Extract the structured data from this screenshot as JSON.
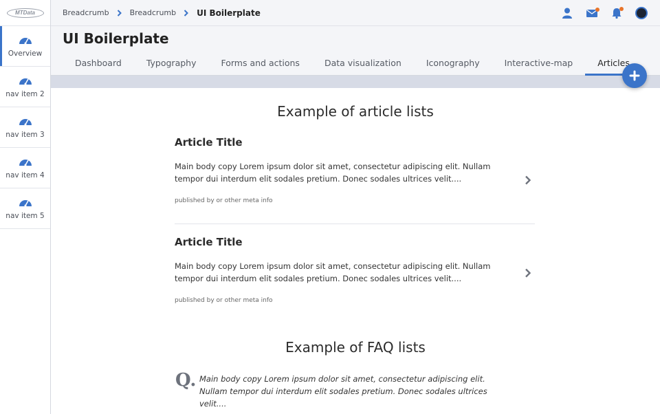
{
  "app": {
    "logo_text": "MTData",
    "page_title": "UI Boilerplate"
  },
  "sidebar": {
    "items": [
      {
        "label": "Overview"
      },
      {
        "label": "nav item 2"
      },
      {
        "label": "nav item 3"
      },
      {
        "label": "nav item 4"
      },
      {
        "label": "nav item 5"
      }
    ]
  },
  "breadcrumb": [
    "Breadcrumb",
    "Breadcrumb",
    "UI Boilerplate"
  ],
  "tabs": [
    {
      "label": "Dashboard"
    },
    {
      "label": "Typography"
    },
    {
      "label": "Forms and actions"
    },
    {
      "label": "Data visualization"
    },
    {
      "label": "Iconography"
    },
    {
      "label": "Interactive-map"
    },
    {
      "label": "Articles"
    }
  ],
  "articles_section": {
    "title": "Example of article lists",
    "items": [
      {
        "title": "Article Title",
        "body": "Main body copy Lorem ipsum dolor sit amet, consectetur adipiscing elit. Nullam tempor dui interdum elit sodales pretium. Donec sodales ultrices velit....",
        "meta": "published by or other meta info"
      },
      {
        "title": "Article Title",
        "body": "Main body copy Lorem ipsum dolor sit amet, consectetur adipiscing elit. Nullam tempor dui interdum elit sodales pretium. Donec sodales ultrices velit....",
        "meta": "published by or other meta info"
      }
    ]
  },
  "faq_section": {
    "title": "Example of FAQ lists",
    "items": [
      {
        "q_marker": "Q.",
        "body": "Main body copy Lorem ipsum dolor sit amet, consectetur adipiscing elit. Nullam tempor dui interdum elit sodales pretium. Donec sodales ultrices velit...."
      }
    ]
  },
  "colors": {
    "accent": "#3b74c9",
    "notification": "#e8742a"
  },
  "icons": {
    "nav": "gauge-icon",
    "fab": "plus-icon",
    "user": "user-icon",
    "mail": "mail-icon",
    "bell": "bell-icon"
  }
}
